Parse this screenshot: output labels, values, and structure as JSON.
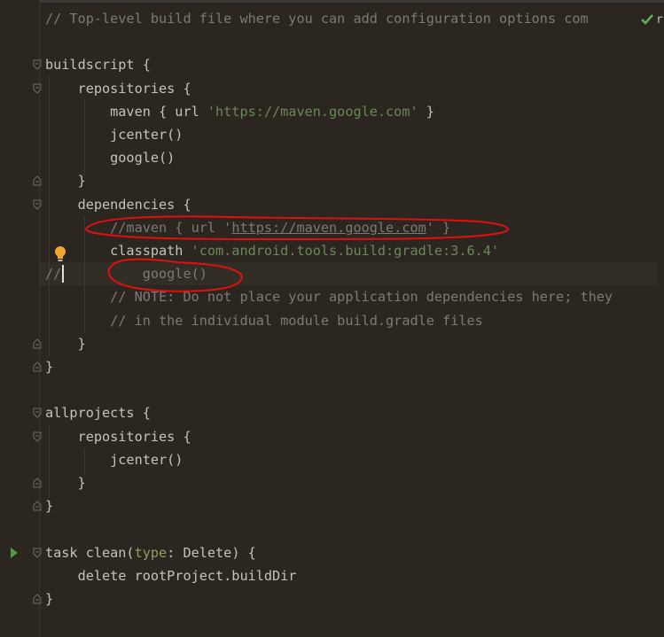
{
  "editor": {
    "cut_letter": "r",
    "lines": [
      {
        "id": "comment-top",
        "parts": [
          {
            "t": "// Top-level build file where you can add configuration options com",
            "c": "cmt"
          }
        ]
      },
      {
        "id": "blank-1",
        "parts": []
      },
      {
        "id": "buildscript",
        "parts": [
          {
            "t": "buildscript {",
            "c": "plain"
          }
        ]
      },
      {
        "id": "repositories-1",
        "parts": [
          {
            "t": "    repositories {",
            "c": "plain"
          }
        ]
      },
      {
        "id": "maven-google",
        "parts": [
          {
            "t": "        maven { url ",
            "c": "plain"
          },
          {
            "t": "'https://maven.google.com'",
            "c": "str"
          },
          {
            "t": " }",
            "c": "plain"
          }
        ]
      },
      {
        "id": "jcenter-1",
        "parts": [
          {
            "t": "        jcenter()",
            "c": "plain"
          }
        ]
      },
      {
        "id": "google-1",
        "parts": [
          {
            "t": "        google()",
            "c": "plain"
          }
        ]
      },
      {
        "id": "close-repositories-1",
        "parts": [
          {
            "t": "    }",
            "c": "plain"
          }
        ]
      },
      {
        "id": "dependencies",
        "parts": [
          {
            "t": "    dependencies {",
            "c": "plain"
          }
        ]
      },
      {
        "id": "commented-maven",
        "parts": [
          {
            "t": "        //maven { url '",
            "c": "cmt"
          },
          {
            "t": "https://maven.google.com",
            "c": "cmt link"
          },
          {
            "t": "' }",
            "c": "cmt"
          }
        ]
      },
      {
        "id": "classpath",
        "parts": [
          {
            "t": "        classpath ",
            "c": "plain"
          },
          {
            "t": "'com.android.tools.build:gradle:3.6.4'",
            "c": "str"
          }
        ]
      },
      {
        "id": "commented-google",
        "parts": [
          {
            "t": "//",
            "c": "cmt"
          },
          {
            "t": "          google()",
            "c": "cmt"
          }
        ]
      },
      {
        "id": "note-comment",
        "parts": [
          {
            "t": "        // NOTE: Do not place your application dependencies here; they",
            "c": "cmt"
          }
        ]
      },
      {
        "id": "module-comment",
        "parts": [
          {
            "t": "        // in the individual module build.gradle files",
            "c": "cmt"
          }
        ]
      },
      {
        "id": "close-dependencies",
        "parts": [
          {
            "t": "    }",
            "c": "plain"
          }
        ]
      },
      {
        "id": "close-buildscript",
        "parts": [
          {
            "t": "}",
            "c": "plain"
          }
        ]
      },
      {
        "id": "blank-2",
        "parts": []
      },
      {
        "id": "allprojects",
        "parts": [
          {
            "t": "allprojects {",
            "c": "plain"
          }
        ]
      },
      {
        "id": "repositories-2",
        "parts": [
          {
            "t": "    repositories {",
            "c": "plain"
          }
        ]
      },
      {
        "id": "jcenter-2",
        "parts": [
          {
            "t": "        jcenter()",
            "c": "plain"
          }
        ]
      },
      {
        "id": "close-repositories-2",
        "parts": [
          {
            "t": "    }",
            "c": "plain"
          }
        ]
      },
      {
        "id": "close-allprojects",
        "parts": [
          {
            "t": "}",
            "c": "plain"
          }
        ]
      },
      {
        "id": "blank-3",
        "parts": []
      },
      {
        "id": "task-clean",
        "parts": [
          {
            "t": "task clean(",
            "c": "plain"
          },
          {
            "t": "type",
            "c": "param"
          },
          {
            "t": ": Delete) {",
            "c": "plain"
          }
        ]
      },
      {
        "id": "delete-builddir",
        "parts": [
          {
            "t": "    delete rootProject.buildDir",
            "c": "plain"
          }
        ]
      },
      {
        "id": "close-task",
        "parts": [
          {
            "t": "}",
            "c": "plain"
          }
        ]
      }
    ]
  },
  "icons": {
    "fold": "fold-marker-icon",
    "bulb": "intention-bulb-icon",
    "run": "run-gutter-icon",
    "check": "inspection-ok-icon"
  },
  "colors": {
    "background": "#2b2620",
    "comment": "#7c7a75",
    "string": "#6a8759",
    "text": "#c3c3bd",
    "annotation": "#e01010",
    "bulb": "#f0a732",
    "run": "#4f9a46",
    "check": "#5fb05a"
  }
}
